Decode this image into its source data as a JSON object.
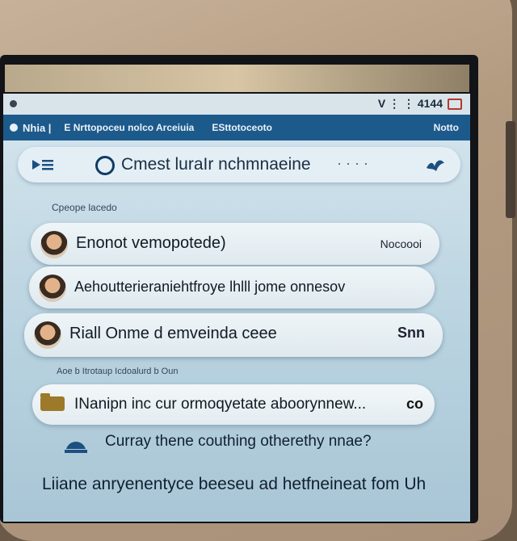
{
  "status_bar": {
    "right_text": "V ⋮ ⋮ 4144"
  },
  "app_header": {
    "title": "Nhia |",
    "label1": "E Nrttopoceu nolco Arceiuia",
    "label2": "ESttotoceoto",
    "label3": "Notto"
  },
  "search": {
    "query": "Cmest luraIr nchmnaeine",
    "ellipsis": "· · · ·"
  },
  "sections": {
    "recent": "Cpeope lacedo",
    "notifications": "Aoe b Itrotaup Icdoalurd b Oun"
  },
  "chats": [
    {
      "name": "Enonot vemopotede)",
      "meta": "Nocoooi"
    },
    {
      "name": "Aehoutterieraniehtfroye lhlll jome onnesov",
      "meta": ""
    },
    {
      "name": "Riall Onme d emveinda ceee",
      "meta": "Snn"
    }
  ],
  "notice": {
    "text": "INanipn inc cur ormoqyetate aboorynnew...",
    "meta": "co"
  },
  "footer": {
    "line1": "Curray thene couthing otherethy nnae?",
    "line2": "Liiane anryenentyce beeseu ad hetfneineat fom Uh"
  },
  "colors": {
    "header": "#1d5a8c",
    "screen": "#c3dae6",
    "battery": "#b03a2e"
  }
}
